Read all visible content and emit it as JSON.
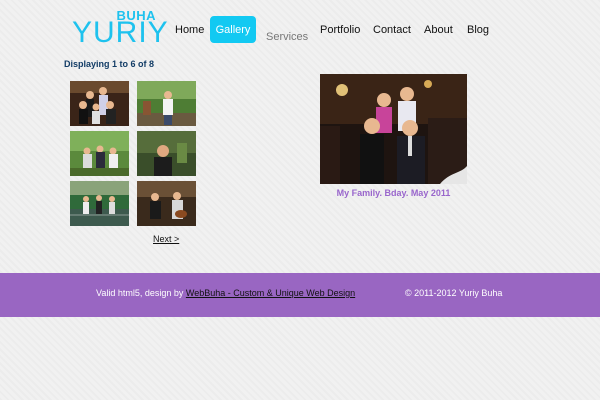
{
  "logo": {
    "small": "BUHA",
    "big": "YURIY"
  },
  "nav": {
    "home": "Home",
    "gallery": "Gallery",
    "services": "Services",
    "portfolio": "Portfolio",
    "contact": "Contact",
    "about": "About",
    "blog": "Blog"
  },
  "gallery": {
    "display_count": "Displaying 1 to 6 of 8",
    "next_label": "Next >",
    "caption": "My Family. Bday. May 2011"
  },
  "footer": {
    "prefix": "Valid html5, design by ",
    "link_text": "WebBuha - Custom & Unique Web Design",
    "copyright": "© 2011-2012 Yuriy Buha"
  },
  "colors": {
    "accent": "#1ec2ee",
    "nav_active_bg": "#12c9f2",
    "footer_bg": "#9966c2",
    "caption": "#9966cc",
    "heading": "#123c66"
  }
}
